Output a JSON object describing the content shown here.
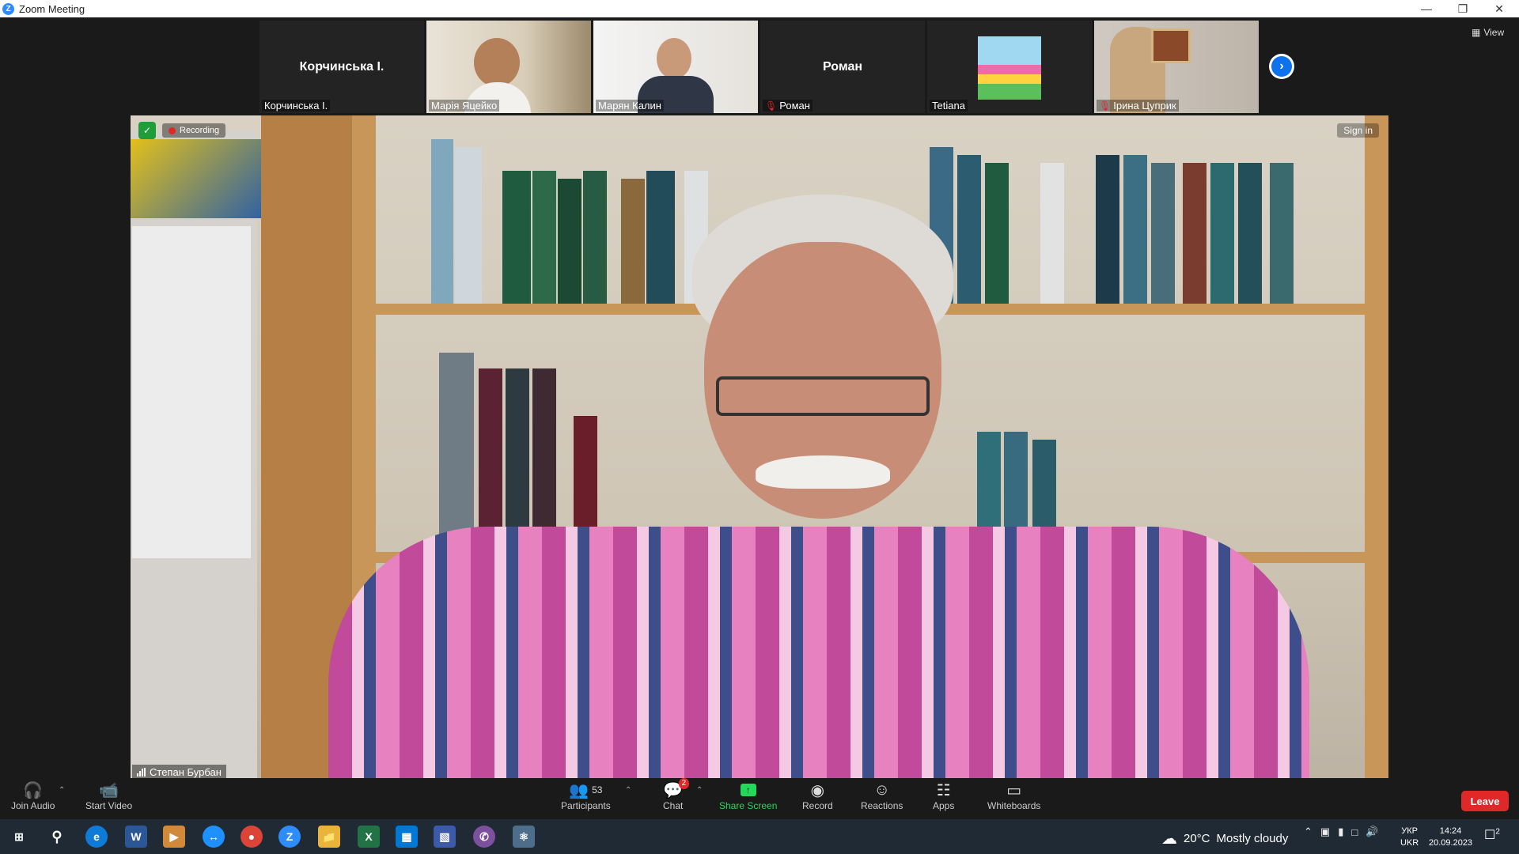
{
  "window": {
    "title": "Zoom Meeting"
  },
  "thumbnails": [
    {
      "display_name": "Корчинська І.",
      "label": "Корчинська І.",
      "mic_muted": false,
      "has_video": false
    },
    {
      "display_name": "",
      "label": "Марія Яцейко",
      "mic_muted": false,
      "has_video": true
    },
    {
      "display_name": "",
      "label": "Марян Калин",
      "mic_muted": false,
      "has_video": true
    },
    {
      "display_name": "Роман",
      "label": "Роман",
      "mic_muted": true,
      "has_video": false
    },
    {
      "display_name": "",
      "label": "Tetiana",
      "mic_muted": false,
      "has_video": false
    },
    {
      "display_name": "",
      "label": "Ірина Цуприк",
      "mic_muted": true,
      "has_video": true
    }
  ],
  "view_button": "View",
  "main_video": {
    "recording_label": "Recording",
    "sign_in": "Sign in",
    "speaker_name": "Степан Бурбан"
  },
  "toolbar": {
    "join_audio": "Join Audio",
    "start_video": "Start Video",
    "participants": "Participants",
    "participants_count": "53",
    "chat": "Chat",
    "chat_badge": "2",
    "share_screen": "Share Screen",
    "record": "Record",
    "reactions": "Reactions",
    "apps": "Apps",
    "whiteboards": "Whiteboards",
    "leave": "Leave"
  },
  "taskbar": {
    "weather_temp": "20°C",
    "weather_desc": "Mostly cloudy",
    "lang_top": "УКР",
    "lang_bottom": "UKR",
    "time": "14:24",
    "date": "20.09.2023",
    "notification_count": "2"
  },
  "colors": {
    "accent_blue": "#0e72ed",
    "share_green": "#23d959",
    "leave_red": "#e02828",
    "background": "#1a1a1a"
  }
}
